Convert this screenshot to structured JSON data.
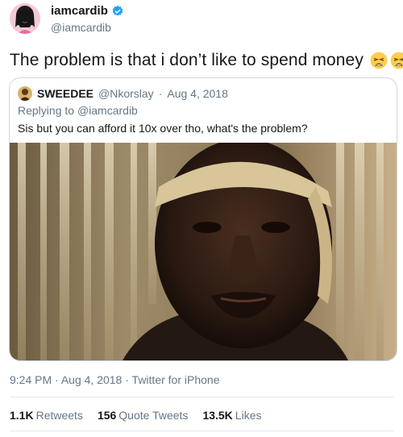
{
  "author": {
    "display_name": "iamcardib",
    "handle": "@iamcardib",
    "verified_color": "#1da1f2"
  },
  "tweet": {
    "text": "The problem is that i don’t like to spend money",
    "emojis": [
      "weary-face-emoji",
      "weary-face-emoji"
    ]
  },
  "quoted_tweet": {
    "name": "SWEEDEE",
    "handle": "@Nkorslay",
    "separator": "·",
    "date": "Aug 4, 2018",
    "replying_to_label": "Replying to",
    "replying_to_handle": "@iamcardib",
    "text": "Sis but you can afford it 10x over  tho, what's the problem?",
    "image": "photo of a man looking at the camera in front of sheer curtains"
  },
  "meta": {
    "time": "9:24 PM",
    "separator": "·",
    "date": "Aug 4, 2018",
    "source_separator": "·",
    "source": "Twitter for iPhone"
  },
  "stats": {
    "retweets_count": "1.1K",
    "retweets_label": "Retweets",
    "quotes_count": "156",
    "quotes_label": "Quote Tweets",
    "likes_count": "13.5K",
    "likes_label": "Likes"
  },
  "colors": {
    "text": "#14171a",
    "secondary": "#657786",
    "border": "#ccd6dd",
    "link": "#1da1f2"
  }
}
